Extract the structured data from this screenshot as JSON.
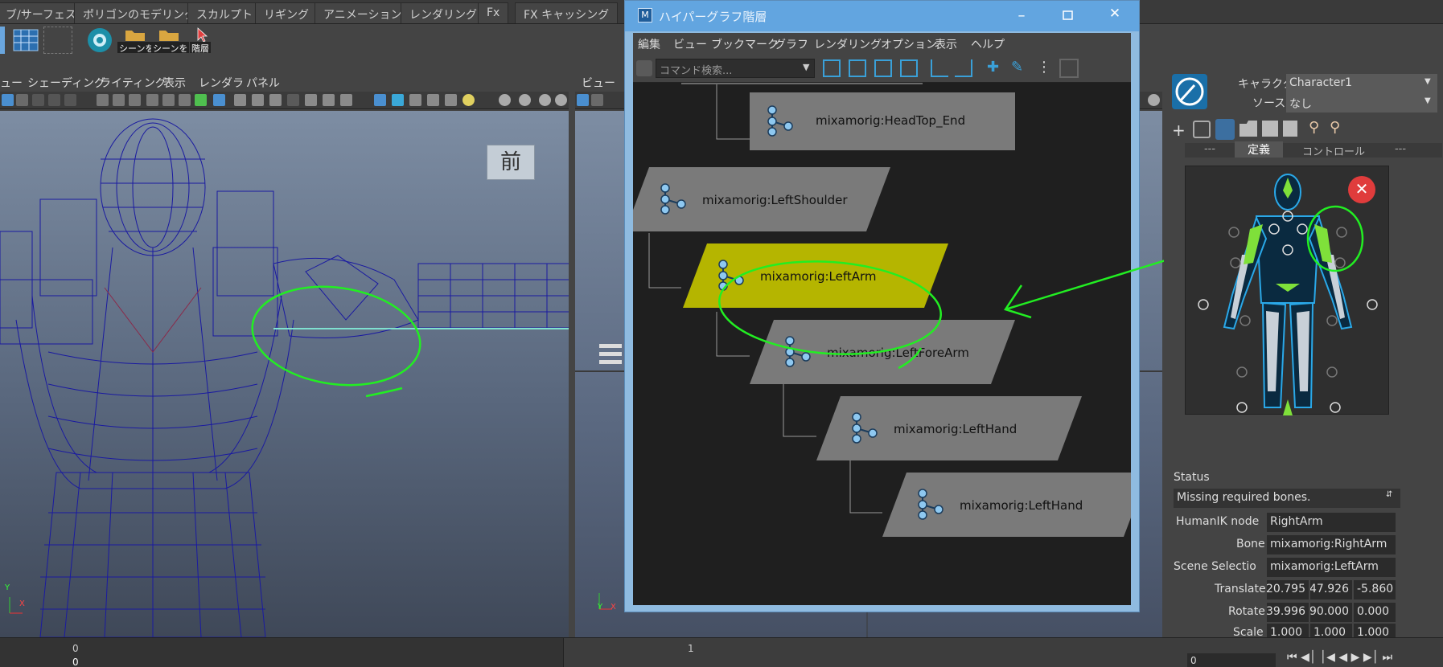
{
  "shelf": {
    "tabs": [
      "ブ/サーフェス",
      "ポリゴンのモデリング",
      "スカルプト",
      "リギング",
      "アニメーション",
      "レンダリング",
      "Fx",
      "FX キャッシング"
    ],
    "icon_labels": [
      "シーンを",
      "シーンを",
      "階層"
    ]
  },
  "viewport_left": {
    "menu": [
      "ュー",
      "シェーディング",
      "ライティング",
      "表示",
      "レンダラ",
      "パネル"
    ],
    "view_badge": "前",
    "axis_y": "Y",
    "axis_x": "X"
  },
  "viewport_mid": {
    "menu": [
      "ビュー"
    ],
    "axis_y": "Y",
    "axis_x": "X"
  },
  "hypergraph": {
    "title": "ハイパーグラフ階層",
    "menu": [
      "編集",
      "ビュー",
      "ブックマーク",
      "グラフ",
      "レンダリング",
      "オプション",
      "表示",
      "ヘルプ"
    ],
    "search_placeholder": "コマンド検索...",
    "nodes": [
      {
        "label": "mixamorig:HeadTop_End",
        "selected": false
      },
      {
        "label": "mixamorig:LeftShoulder",
        "selected": false
      },
      {
        "label": "mixamorig:LeftArm",
        "selected": true
      },
      {
        "label": "mixamorig:LeftForeArm",
        "selected": false
      },
      {
        "label": "mixamorig:LeftHand",
        "selected": false
      },
      {
        "label": "mixamorig:LeftHand",
        "selected": false
      }
    ]
  },
  "humanik": {
    "character_label": "キャラクタ:",
    "character_value": "Character1",
    "source_label": "ソース:",
    "source_value": "なし",
    "tabs": [
      "---",
      "定義",
      "コントロール",
      "---"
    ],
    "active_tab": "定義",
    "status_heading": "Status",
    "status_value": "Missing required bones.",
    "humanik_node_label": "HumanIK node",
    "humanik_node_value": "RightArm",
    "bone_label": "Bone",
    "bone_value": "mixamorig:RightArm",
    "scene_selection_label": "Scene Selectio",
    "scene_selection_value": "mixamorig:LeftArm",
    "translate_label": "Translate",
    "translate": [
      "20.795",
      "47.926",
      "-5.860"
    ],
    "rotate_label": "Rotate",
    "rotate": [
      "39.996",
      "90.000",
      "0.000"
    ],
    "scale_label": "Scale",
    "scale": [
      "1.000",
      "1.000",
      "1.000"
    ]
  },
  "timeline": {
    "tick_0": "0",
    "tick_0_sub": "0",
    "tick_1": "1",
    "current_frame": "0"
  },
  "colors": {
    "selected_node": "#b5b500",
    "node": "#7a7a7a",
    "annotation": "#22ee22",
    "wire": "#1a1aa0"
  }
}
